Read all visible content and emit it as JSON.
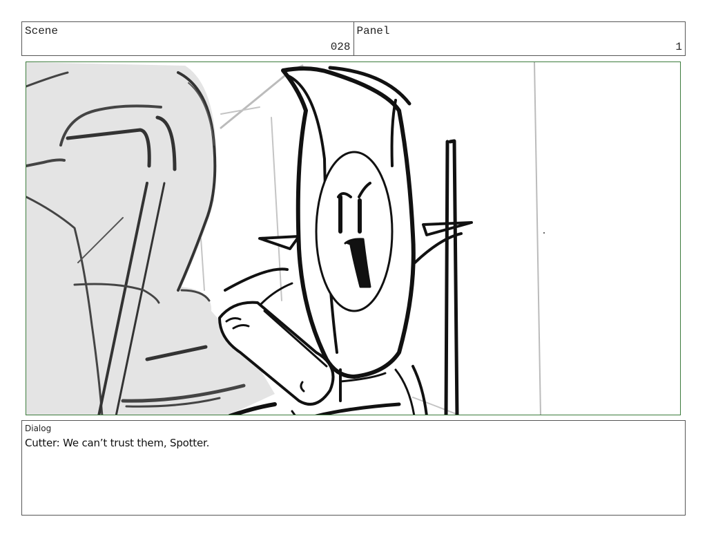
{
  "header": {
    "scene_label": "Scene",
    "scene_value": "028",
    "panel_label": "Panel",
    "panel_value": "1"
  },
  "artwork": {
    "description_icon": "storyboard-sketch"
  },
  "dialog": {
    "label": "Dialog",
    "text": "Cutter: We can’t trust them, Spotter."
  }
}
